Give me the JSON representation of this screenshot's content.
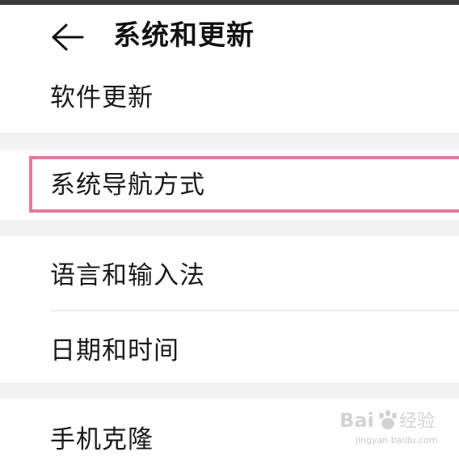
{
  "header": {
    "back_icon": "arrow-left-icon",
    "title": "系统和更新"
  },
  "settings": {
    "software_update": "软件更新",
    "system_navigation": "系统导航方式",
    "language_input": "语言和输入法",
    "date_time": "日期和时间",
    "phone_clone": "手机克隆"
  },
  "colors": {
    "highlight": "#e07aa0",
    "section_gap": "#f2f2f2"
  },
  "watermark": {
    "brand": "Baidu经验",
    "url": "jingyan.baidu.com"
  }
}
